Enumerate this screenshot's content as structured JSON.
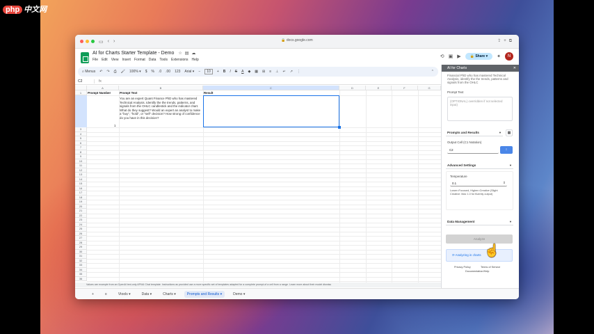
{
  "watermark": {
    "badge": "php",
    "text": "中文网"
  },
  "browser": {
    "url": "docs.google.com"
  },
  "doc": {
    "title": "AI for Charts Starter Template - Demo",
    "menus": [
      "File",
      "Edit",
      "View",
      "Insert",
      "Format",
      "Data",
      "Tools",
      "Extensions",
      "Help"
    ],
    "share_label": "Share",
    "avatar_letter": "N"
  },
  "toolbar": {
    "menus": "Menus",
    "zoom": "100%",
    "currency": "$",
    "percent": "%",
    "decimal1": ".0",
    "decimal2": ".00",
    "numformat": "123",
    "font": "Arial",
    "font_size": "10",
    "bold": "B",
    "italic": "I",
    "strike": "S",
    "text_color": "A"
  },
  "fx": {
    "name_box": "C2",
    "fx": "fx"
  },
  "grid": {
    "columns": [
      "A",
      "B",
      "C",
      "D",
      "E",
      "F",
      "G"
    ],
    "headers": {
      "a": "Prompt Number",
      "b": "Prompt Text",
      "c": "Result"
    },
    "row2": {
      "a": "1",
      "b": "You are an expert Quant Finance PhD who has mastered Technical Analysis. Identify the the trends, patterns, and signals from the OHLC candlestick and the indicator chart. What do they suggest? Would an expert an analyst to make a \"buy\", \"hold\", or \"sell\" decision? How strong of confidence do you have in this decision?"
    },
    "rows": [
      "1",
      "2",
      "3",
      "4",
      "5",
      "6",
      "7",
      "8",
      "9",
      "10",
      "11",
      "12",
      "13",
      "14",
      "15",
      "16",
      "17",
      "18",
      "19",
      "20",
      "21",
      "22",
      "23",
      "24",
      "25",
      "26",
      "27",
      "28",
      "29",
      "30",
      "31",
      "32",
      "33",
      "34",
      "35",
      "36"
    ]
  },
  "footnote": "Values are example from an OpenAI text-only API/AI Chat template. Instructions as provided use a more specific set of templates adapted for a complete prompt-of a cell from a range. Learn more about their model  dismiss",
  "tabs": [
    "+",
    "≡",
    "Vtools",
    "Data",
    "Charts",
    "Prompts and Results",
    "Demo"
  ],
  "panel": {
    "title": "AI for Charts",
    "intro": "Financial PhD who has mastered Technical Analysis, identify the the trends, patterns and signals from the OHLC",
    "prompt_text_label": "Prompt Text",
    "prompt_placeholder": "(OPTIONAL) overridden if not selected input)",
    "prompts_results_label": "Prompts and Results",
    "output_cell_label": "Output Cell (C1 Notation)",
    "output_cell_value": "C2",
    "advanced_label": "Advanced Settings",
    "temperature_label": "Temperature",
    "temperature_value": "0.1",
    "temp_help": "Lower=Focused, Higher=Creative (Slight Creative: Max 1.0 for fluently output)",
    "data_mgmt_label": "Data Management",
    "run_label": "Analyze",
    "status": "Analyzing in charts",
    "privacy": "Privacy Policy",
    "terms": "Terms of Service",
    "docs": "Documentation/Help"
  }
}
